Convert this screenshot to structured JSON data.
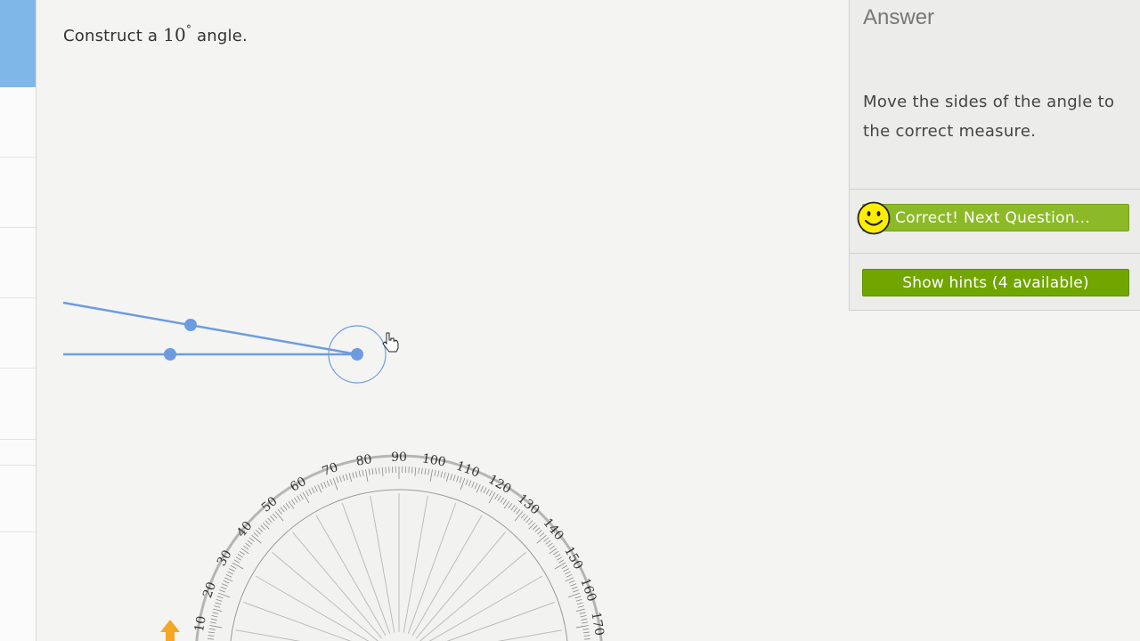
{
  "question": {
    "prefix": "Construct a",
    "angle_value": "10",
    "degree_symbol": "°",
    "suffix": "angle."
  },
  "answer_panel": {
    "title": "Answer",
    "instruction": "Move the sides of the angle to the correct measure.",
    "correct_button_label": "Correct! Next Question...",
    "hints_button_label": "Show hints (4 available)"
  },
  "protractor": {
    "tick_labels": [
      "20",
      "30",
      "40",
      "50",
      "60",
      "70",
      "80",
      "90",
      "100",
      "110",
      "120",
      "130",
      "140",
      "150",
      "160",
      "170"
    ],
    "partial_labels": [
      "10"
    ]
  },
  "icons": {
    "smiley": "smiley-face-icon",
    "cursor": "hand-pointer-icon",
    "rotate_handle": "orange-arrow-icon"
  },
  "colors": {
    "angle_line": "#6e9be0",
    "correct_button": "#8cb927",
    "hints_button": "#71a600",
    "left_tab_active": "#7fb8e8"
  }
}
